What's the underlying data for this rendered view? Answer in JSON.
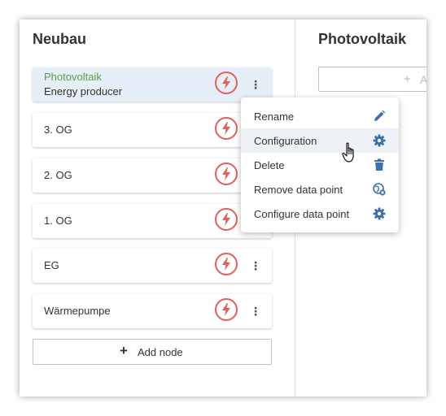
{
  "colors": {
    "accent_green": "#5a9f46",
    "bolt_red": "#e06060",
    "icon_blue": "#3f6fa8"
  },
  "left_panel": {
    "title": "Neubau",
    "nodes": [
      {
        "title": "Photovoltaik",
        "subtitle": "Energy producer",
        "selected": true,
        "icon": "lightning-bolt-icon"
      },
      {
        "label": "3. OG",
        "icon": "lightning-bolt-icon"
      },
      {
        "label": "2. OG",
        "icon": "lightning-bolt-icon"
      },
      {
        "label": "1. OG",
        "icon": "lightning-bolt-icon"
      },
      {
        "label": "EG",
        "icon": "lightning-bolt-icon"
      },
      {
        "label": "Wärmepumpe",
        "icon": "lightning-bolt-icon"
      }
    ],
    "add_node_label": "Add node"
  },
  "right_panel": {
    "title": "Photovoltaik",
    "add_button_partial": "A"
  },
  "context_menu": {
    "items": [
      {
        "label": "Rename",
        "icon": "pencil-icon"
      },
      {
        "label": "Configuration",
        "icon": "gear-icon",
        "hovered": true
      },
      {
        "label": "Delete",
        "icon": "trash-icon"
      },
      {
        "label": "Remove data point",
        "icon": "remove-data-point-icon"
      },
      {
        "label": "Configure data point",
        "icon": "gear-icon"
      }
    ]
  }
}
